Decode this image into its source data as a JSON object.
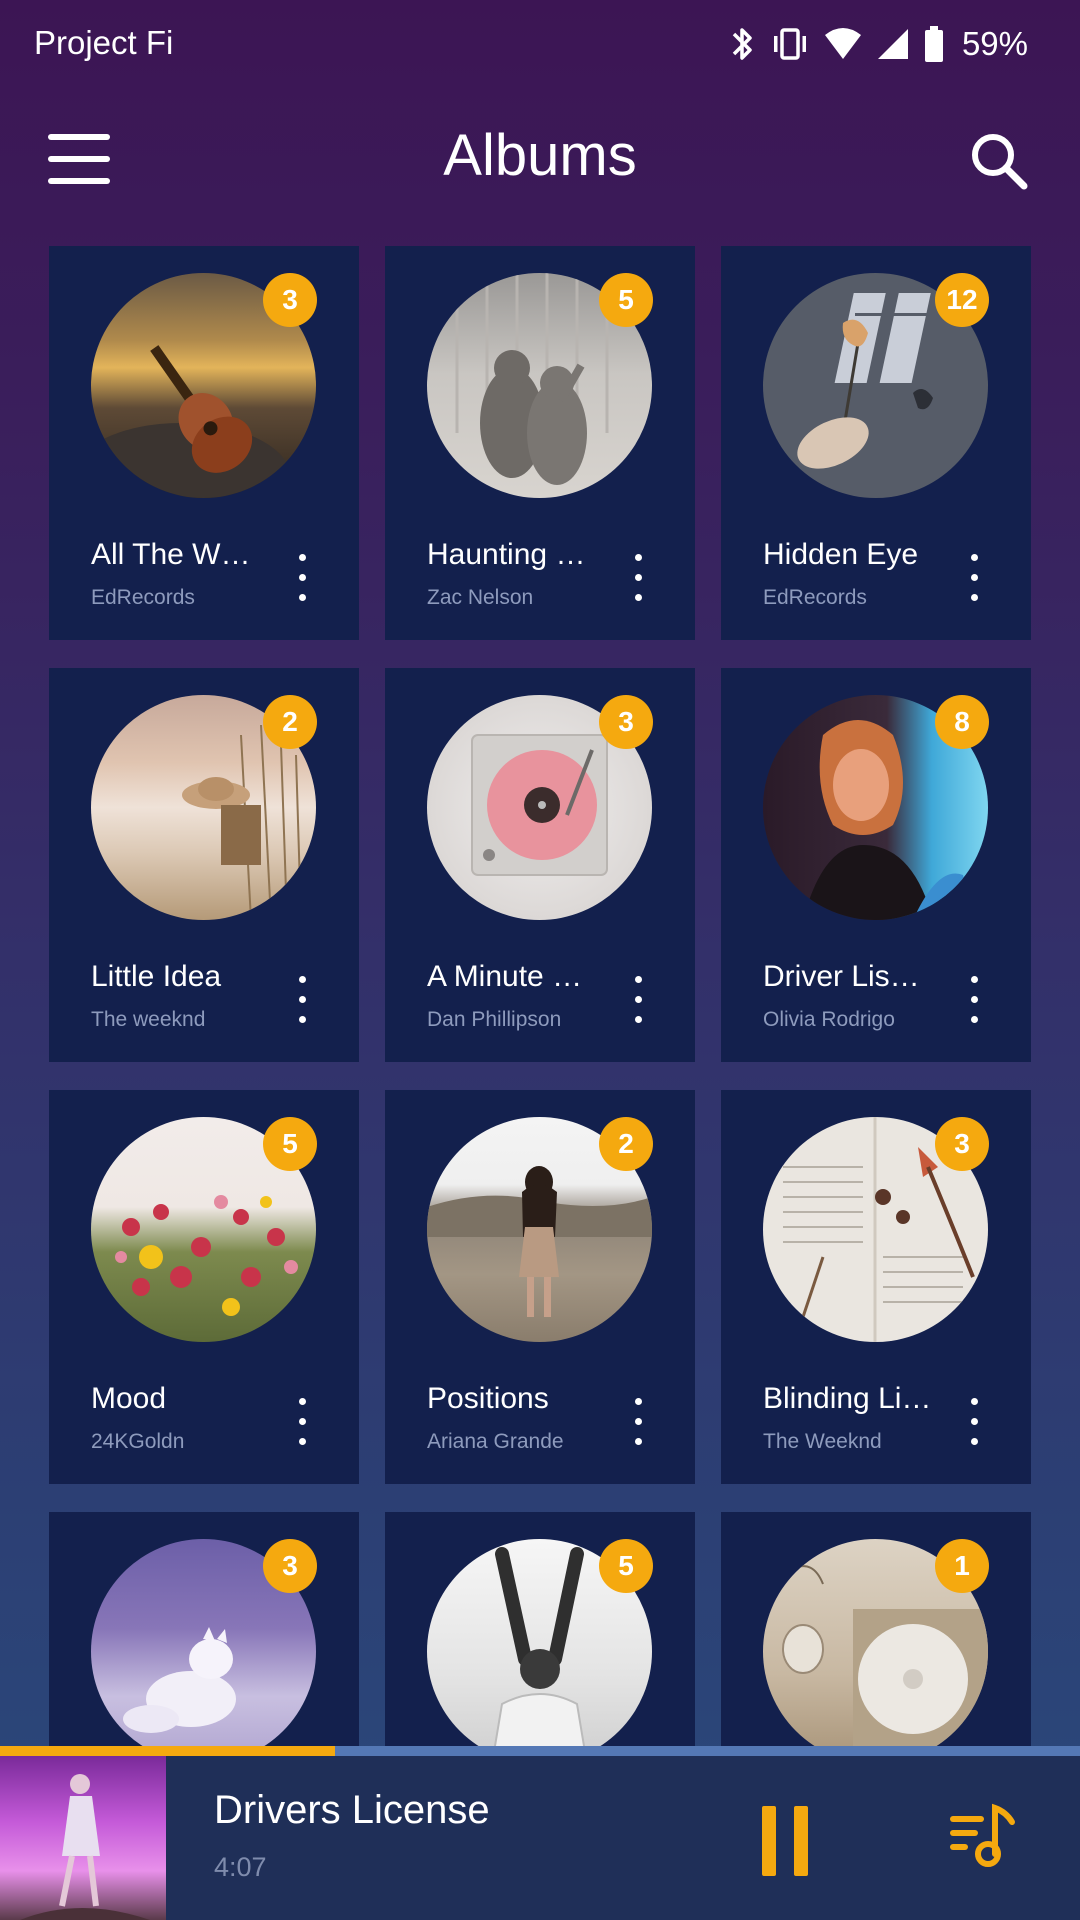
{
  "status_bar": {
    "carrier": "Project Fi",
    "battery_percent": "59%",
    "icons": [
      "bluetooth-icon",
      "vibrate-icon",
      "wifi-icon",
      "cell-signal-icon",
      "battery-icon"
    ]
  },
  "app_bar": {
    "title": "Albums",
    "menu_icon": "menu-icon",
    "search_icon": "search-icon"
  },
  "albums": [
    {
      "title": "All The W…",
      "artist": "EdRecords",
      "count": "3"
    },
    {
      "title": "Haunting W…",
      "artist": "Zac Nelson",
      "count": "5"
    },
    {
      "title": "Hidden Eye",
      "artist": "EdRecords",
      "count": "12"
    },
    {
      "title": "Little Idea",
      "artist": "The weeknd",
      "count": "2"
    },
    {
      "title": "A Minute Lo…",
      "artist": "Dan Phillipson",
      "count": "3"
    },
    {
      "title": "Driver Lis…",
      "artist": "Olivia Rodrigo",
      "count": "8"
    },
    {
      "title": "Mood",
      "artist": "24KGoldn",
      "count": "5"
    },
    {
      "title": "Positions",
      "artist": "Ariana Grande",
      "count": "2"
    },
    {
      "title": "Blinding Li…",
      "artist": "The Weeknd",
      "count": "3"
    },
    {
      "title": "",
      "artist": "",
      "count": "3"
    },
    {
      "title": "",
      "artist": "",
      "count": "5"
    },
    {
      "title": "",
      "artist": "",
      "count": "1"
    }
  ],
  "now_playing": {
    "title": "Drivers License",
    "duration": "4:07",
    "progress": 0.31
  },
  "colors": {
    "accent": "#f5a90f",
    "card_background": "#13204d",
    "player_background": "#1f2f58",
    "secondary_text": "#8e9bbd"
  }
}
